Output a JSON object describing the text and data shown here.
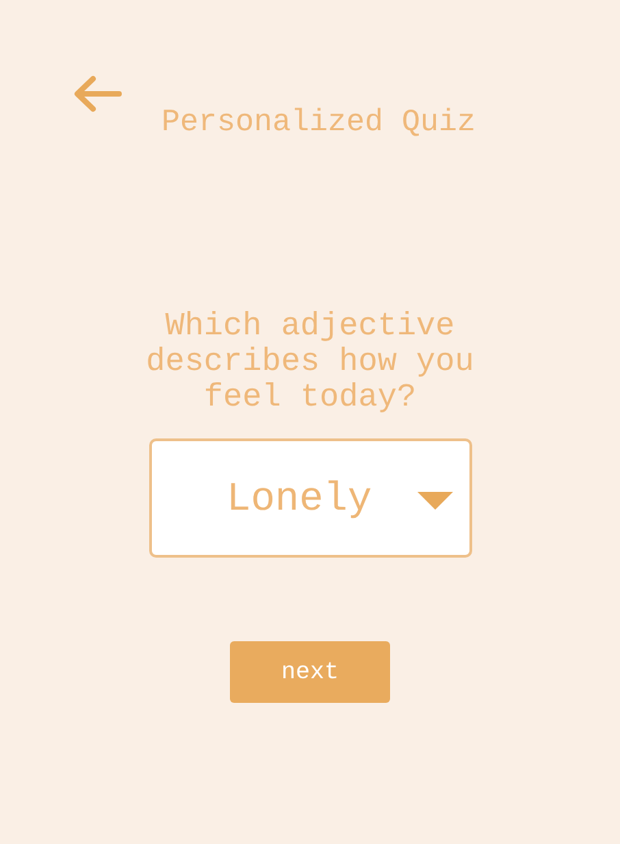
{
  "header": {
    "title": "Personalized Quiz"
  },
  "question": {
    "text": "Which adjective describes how you feel today?"
  },
  "dropdown": {
    "value": "Lonely"
  },
  "buttons": [
    {
      "label": "next",
      "kind": "primary"
    }
  ]
}
